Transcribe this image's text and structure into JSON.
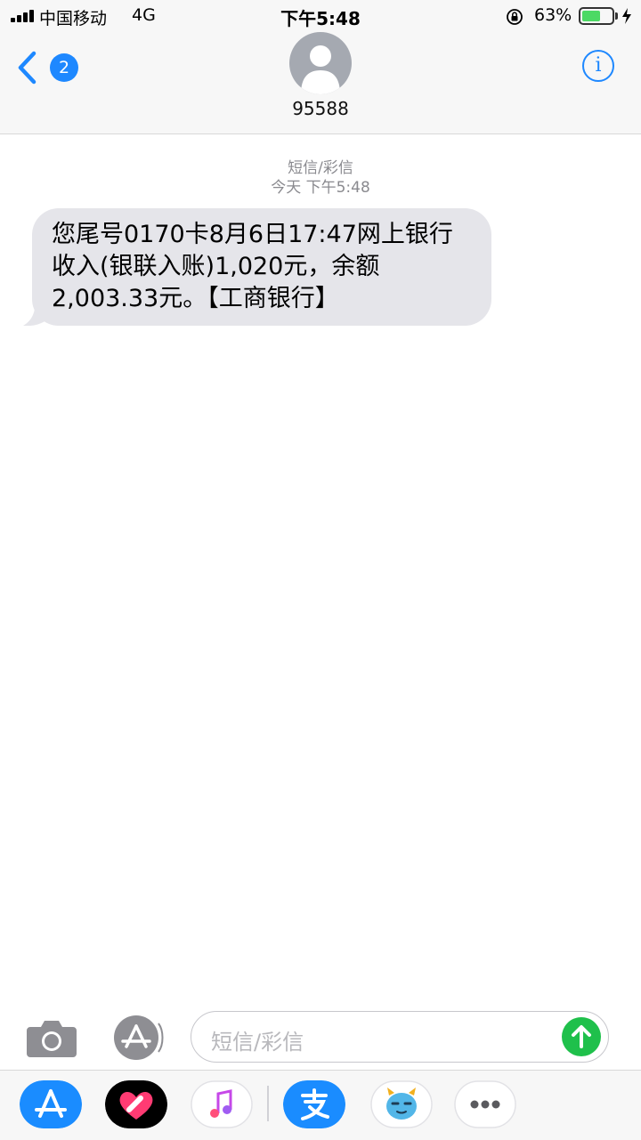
{
  "status_bar": {
    "carrier": "中国移动",
    "network": "4G",
    "time": "下午5:48",
    "battery_percent": "63%",
    "battery_level": 0.63,
    "battery_color": "#4cd964"
  },
  "header": {
    "unread_count": "2",
    "contact_name": "95588",
    "info_label": "i"
  },
  "conversation": {
    "message_type": "短信/彩信",
    "timestamp": "今天 下午5:48",
    "messages": [
      {
        "direction": "incoming",
        "text": "您尾号0170卡8月6日17:47网上银行\n收入(银联入账)1,020元，余额\n2,003.33元。【工商银行】"
      }
    ]
  },
  "input_bar": {
    "placeholder": "短信/彩信",
    "send_color": "#1fc04b"
  },
  "app_drawer": {
    "apps": [
      {
        "icon": "app-store-icon"
      },
      {
        "icon": "digital-touch-icon"
      },
      {
        "icon": "music-icon"
      },
      {
        "icon": "alipay-icon"
      },
      {
        "icon": "sticker-icon"
      },
      {
        "icon": "more-icon"
      }
    ]
  },
  "colors": {
    "accent": "#1e88ff",
    "bubble_incoming": "#e5e5ea"
  }
}
